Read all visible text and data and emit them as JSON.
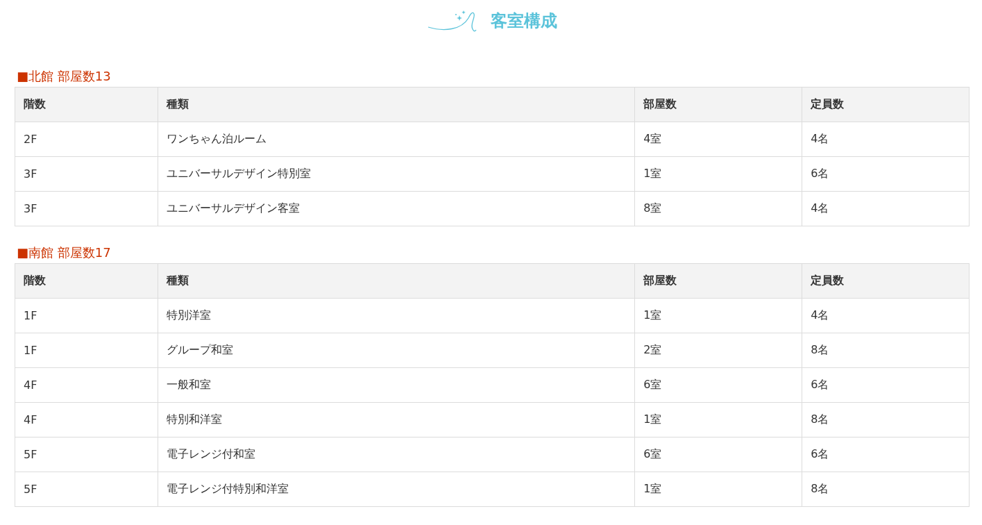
{
  "title": "客室構成",
  "sections": [
    {
      "heading": "■北館 部屋数13",
      "columns": [
        "階数",
        "種類",
        "部屋数",
        "定員数"
      ],
      "rows": [
        [
          "2F",
          "ワンちゃん泊ルーム",
          "4室",
          "4名"
        ],
        [
          "3F",
          "ユニバーサルデザイン特別室",
          "1室",
          "6名"
        ],
        [
          "3F",
          "ユニバーサルデザイン客室",
          "8室",
          "4名"
        ]
      ]
    },
    {
      "heading": "■南館 部屋数17",
      "columns": [
        "階数",
        "種類",
        "部屋数",
        "定員数"
      ],
      "rows": [
        [
          "1F",
          "特別洋室",
          "1室",
          "4名"
        ],
        [
          "1F",
          "グループ和室",
          "2室",
          "8名"
        ],
        [
          "4F",
          "一般和室",
          "6室",
          "6名"
        ],
        [
          "4F",
          "特別和洋室",
          "1室",
          "8名"
        ],
        [
          "5F",
          "電子レンジ付和室",
          "6室",
          "6名"
        ],
        [
          "5F",
          "電子レンジ付特別和洋室",
          "1室",
          "8名"
        ]
      ]
    }
  ]
}
